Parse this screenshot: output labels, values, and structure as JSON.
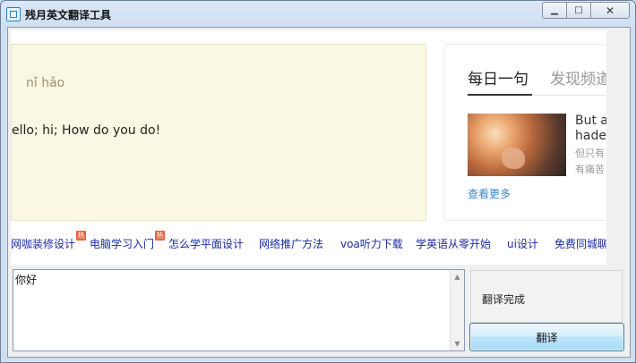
{
  "window": {
    "title": "残月英文翻译工具",
    "icon": "app-icon"
  },
  "controls": {
    "minimize": "▁",
    "maximize": "□",
    "close": "✕"
  },
  "dictionary": {
    "pinyin": "nǐ hǎo",
    "meaning": "ello; hi; How do you do!"
  },
  "daily_sentence": {
    "tabs": [
      "每日一句",
      "发现频道"
    ],
    "quote_lines": [
      "But a",
      "hade",
      "但只有",
      "有痛苦"
    ],
    "more_link": "查看更多"
  },
  "ad_links": [
    {
      "text": "网咖装修设计",
      "hot": true
    },
    {
      "text": "电脑学习入门",
      "hot": true
    },
    {
      "text": "怎么学平面设计",
      "hot": false
    },
    {
      "text": "网络推广方法",
      "hot": false
    },
    {
      "text": "voa听力下载",
      "hot": false
    },
    {
      "text": "学英语从零开始",
      "hot": false
    },
    {
      "text": "ui设计",
      "hot": false
    },
    {
      "text": "免费同城聊",
      "hot": false
    }
  ],
  "hot_badge": "热",
  "input": {
    "value": "你好"
  },
  "status": {
    "text": "翻译完成"
  },
  "translate_button": {
    "label": "翻译"
  },
  "colors": {
    "link": "#1a2aa0",
    "hot_badge": "#e8643c",
    "accent": "#3a86c8"
  }
}
